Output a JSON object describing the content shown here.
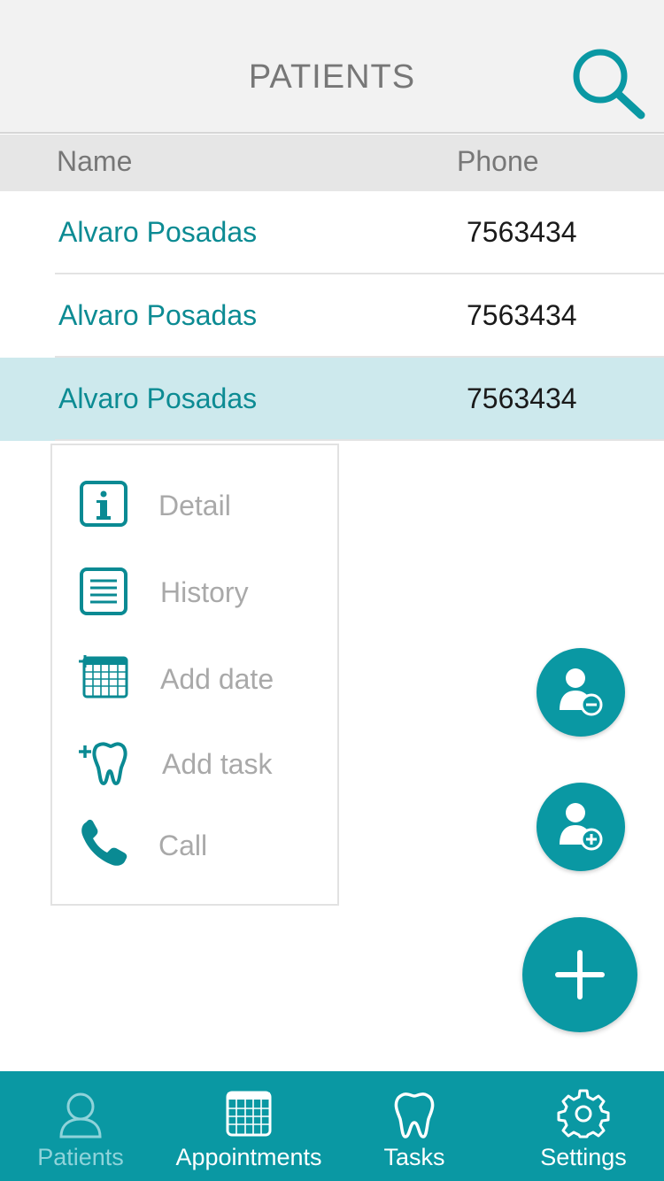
{
  "header": {
    "title": "PATIENTS",
    "search_icon": "search-icon"
  },
  "columns": {
    "name": "Name",
    "phone": "Phone"
  },
  "patients": [
    {
      "name": "Alvaro Posadas",
      "phone": "7563434"
    },
    {
      "name": "Alvaro Posadas",
      "phone": "7563434"
    },
    {
      "name": "Alvaro Posadas",
      "phone": "7563434"
    }
  ],
  "context_menu": {
    "items": [
      {
        "label": "Detail",
        "icon": "info-icon"
      },
      {
        "label": "History",
        "icon": "list-icon"
      },
      {
        "label": "Add date",
        "icon": "calendar-add-icon"
      },
      {
        "label": "Add task",
        "icon": "tooth-add-icon"
      },
      {
        "label": "Call",
        "icon": "phone-icon"
      }
    ]
  },
  "tabs": [
    {
      "label": "Patients",
      "icon": "user-icon",
      "active": true
    },
    {
      "label": "Appointments",
      "icon": "calendar-icon",
      "active": false
    },
    {
      "label": "Tasks",
      "icon": "tooth-icon",
      "active": false
    },
    {
      "label": "Settings",
      "icon": "gear-icon",
      "active": false
    }
  ],
  "colors": {
    "accent": "#0a98a3",
    "link_text": "#0c8b93",
    "selected_row": "#cde9ed",
    "header_bg": "#f2f2f2",
    "menu_label": "#a9a9a9"
  }
}
